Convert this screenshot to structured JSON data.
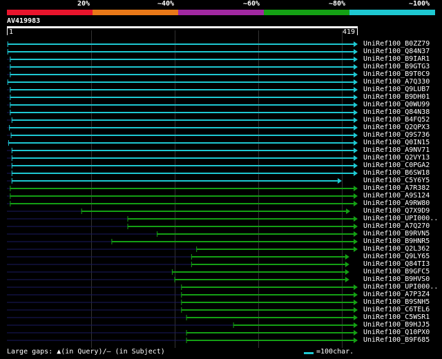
{
  "header": {
    "percent_labels": [
      "20%",
      "~40%",
      "~60%",
      "~80%",
      "~100%"
    ],
    "colors": [
      "#e8142c",
      "#e87818",
      "#a028a0",
      "#14a014",
      "#1ec8d2"
    ]
  },
  "query": {
    "title": "AV419983",
    "start": "1",
    "end": "419",
    "length": 419
  },
  "hits": [
    {
      "name": "UniRef100_B0ZZ79",
      "start": 2,
      "end": 419,
      "color": "cyan"
    },
    {
      "name": "UniRef100_Q84N37",
      "start": 2,
      "end": 419,
      "color": "cyan"
    },
    {
      "name": "UniRef100_B9IAR1",
      "start": 5,
      "end": 419,
      "color": "cyan"
    },
    {
      "name": "UniRef100_B9GTG3",
      "start": 5,
      "end": 419,
      "color": "cyan"
    },
    {
      "name": "UniRef100_B9T0C9",
      "start": 5,
      "end": 419,
      "color": "cyan"
    },
    {
      "name": "UniRef100_A7Q330",
      "start": 2,
      "end": 419,
      "color": "cyan"
    },
    {
      "name": "UniRef100_Q9LUB7",
      "start": 5,
      "end": 419,
      "color": "cyan"
    },
    {
      "name": "UniRef100_B9DH01",
      "start": 5,
      "end": 419,
      "color": "cyan"
    },
    {
      "name": "UniRef100_Q0WU99",
      "start": 5,
      "end": 419,
      "color": "cyan"
    },
    {
      "name": "UniRef100_Q84N38",
      "start": 5,
      "end": 419,
      "color": "cyan"
    },
    {
      "name": "UniRef100_B4FQ52",
      "start": 7,
      "end": 419,
      "color": "cyan"
    },
    {
      "name": "UniRef100_Q2QPX3",
      "start": 4,
      "end": 419,
      "color": "cyan"
    },
    {
      "name": "UniRef100_Q9S736",
      "start": 6,
      "end": 419,
      "color": "cyan"
    },
    {
      "name": "UniRef100_Q0IN15",
      "start": 3,
      "end": 419,
      "color": "cyan"
    },
    {
      "name": "UniRef100_A9NV71",
      "start": 7,
      "end": 419,
      "color": "cyan"
    },
    {
      "name": "UniRef100_Q2VY13",
      "start": 7,
      "end": 419,
      "color": "cyan"
    },
    {
      "name": "UniRef100_C0PGA2",
      "start": 7,
      "end": 419,
      "color": "cyan"
    },
    {
      "name": "UniRef100_B6SW18",
      "start": 7,
      "end": 419,
      "color": "cyan"
    },
    {
      "name": "UniRef100_C5Y6Y5",
      "start": 7,
      "end": 400,
      "color": "cyan"
    },
    {
      "name": "UniRef100_A7R382",
      "start": 5,
      "end": 419,
      "color": "green"
    },
    {
      "name": "UniRef100_A9S124",
      "start": 5,
      "end": 419,
      "color": "green"
    },
    {
      "name": "UniRef100_A9RW80",
      "start": 5,
      "end": 419,
      "color": "green"
    },
    {
      "name": "UniRef100_Q7X9D9",
      "start": 90,
      "end": 410,
      "color": "green"
    },
    {
      "name": "UniRef100_UPI000..",
      "start": 145,
      "end": 419,
      "color": "green"
    },
    {
      "name": "UniRef100_A7Q270",
      "start": 145,
      "end": 419,
      "color": "green"
    },
    {
      "name": "UniRef100_B9RVN5",
      "start": 180,
      "end": 419,
      "color": "green"
    },
    {
      "name": "UniRef100_B9HNR5",
      "start": 126,
      "end": 419,
      "color": "green"
    },
    {
      "name": "UniRef100_Q2L362",
      "start": 227,
      "end": 419,
      "color": "green"
    },
    {
      "name": "UniRef100_Q9LY65",
      "start": 221,
      "end": 409,
      "color": "green"
    },
    {
      "name": "UniRef100_Q84TI3",
      "start": 221,
      "end": 409,
      "color": "green"
    },
    {
      "name": "UniRef100_B9GFC5",
      "start": 198,
      "end": 409,
      "color": "green"
    },
    {
      "name": "UniRef100_B9HVS0",
      "start": 201,
      "end": 409,
      "color": "green"
    },
    {
      "name": "UniRef100_UPI000..",
      "start": 209,
      "end": 419,
      "color": "green"
    },
    {
      "name": "UniRef100_A7P3Z4",
      "start": 209,
      "end": 419,
      "color": "green"
    },
    {
      "name": "UniRef100_B9SNH5",
      "start": 209,
      "end": 419,
      "color": "green"
    },
    {
      "name": "UniRef100_C6TEL6",
      "start": 209,
      "end": 419,
      "color": "green"
    },
    {
      "name": "UniRef100_C5WSR1",
      "start": 215,
      "end": 419,
      "color": "green"
    },
    {
      "name": "UniRef100_B9HJJ5",
      "start": 271,
      "end": 419,
      "color": "green"
    },
    {
      "name": "UniRef100_Q10PX0",
      "start": 215,
      "end": 419,
      "color": "green"
    },
    {
      "name": "UniRef100_B9F685",
      "start": 215,
      "end": 419,
      "color": "green"
    }
  ],
  "footer": {
    "text": "Large gaps: ▲(in Query)/— (in Subject)",
    "scale_text": "=100char."
  }
}
